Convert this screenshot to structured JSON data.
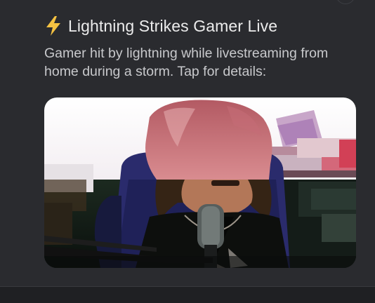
{
  "post": {
    "title_icon": "lightning-bolt-icon",
    "title": "Lightning Strikes Gamer Live",
    "description": "Gamer hit by lightning while livestreaming from home during a storm. Tap for details:"
  },
  "colors": {
    "background": "#1f2023",
    "card": "#2a2b2f",
    "title_text": "#ececec",
    "body_text": "#c8c9cc",
    "bolt": "#f5c242"
  }
}
